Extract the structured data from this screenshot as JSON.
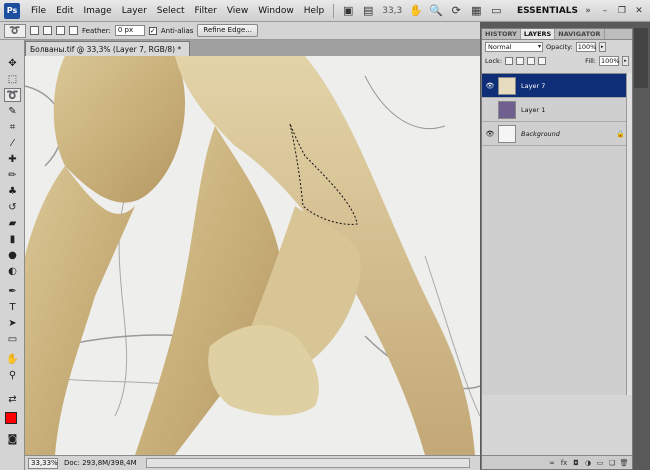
{
  "app": {
    "logo": "Ps",
    "zoom": "33,3",
    "workspace": "ESSENTIALS"
  },
  "menu": [
    "File",
    "Edit",
    "Image",
    "Layer",
    "Select",
    "Filter",
    "View",
    "Window",
    "Help"
  ],
  "options": {
    "feather_label": "Feather:",
    "feather_value": "0 px",
    "antialias_label": "Anti-alias",
    "antialias_checked": true,
    "refine_edge_label": "Refine Edge..."
  },
  "document": {
    "tab_title": "Болваны.tif @ 33,3% (Layer 7, RGB/8) *",
    "status_zoom": "33,33%",
    "status_doc": "Doc: 293,8M/398,4M"
  },
  "tools": [
    "move-tool",
    "marquee-tool",
    "lasso-tool",
    "quick-select-tool",
    "crop-tool",
    "eyedropper-tool",
    "healing-brush-tool",
    "brush-tool",
    "clone-stamp-tool",
    "history-brush-tool",
    "eraser-tool",
    "gradient-tool",
    "blur-tool",
    "dodge-tool",
    "pen-tool",
    "type-tool",
    "path-selection-tool",
    "shape-tool",
    "hand-tool",
    "zoom-tool"
  ],
  "colors": {
    "foreground": "#ff0000",
    "background": "#ffffff",
    "selected_layer": "#0f2e78"
  },
  "layers_panel": {
    "tabs": [
      "HISTORY",
      "LAYERS",
      "NAVIGATOR"
    ],
    "active_tab": "LAYERS",
    "blend_mode": "Normal",
    "opacity_label": "Opacity:",
    "opacity_value": "100%",
    "lock_label": "Lock:",
    "fill_label": "Fill:",
    "fill_value": "100%",
    "layers": [
      {
        "name": "Layer 7",
        "visible": true,
        "selected": true
      },
      {
        "name": "Layer 1",
        "visible": false,
        "selected": false
      },
      {
        "name": "Background",
        "visible": true,
        "selected": false,
        "locked": true
      }
    ]
  }
}
